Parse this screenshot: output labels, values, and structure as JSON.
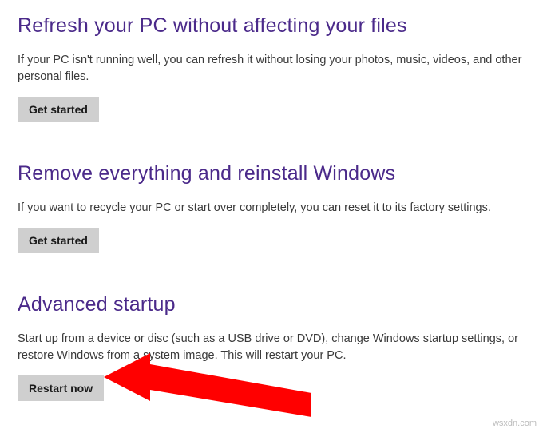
{
  "sections": {
    "refresh": {
      "title": "Refresh your PC without affecting your files",
      "desc": "If your PC isn't running well, you can refresh it without losing your photos, music, videos, and other personal files.",
      "button": "Get started"
    },
    "remove": {
      "title": "Remove everything and reinstall Windows",
      "desc": "If you want to recycle your PC or start over completely, you can reset it to its factory settings.",
      "button": "Get started"
    },
    "advanced": {
      "title": "Advanced startup",
      "desc": "Start up from a device or disc (such as a USB drive or DVD), change Windows startup settings, or restore Windows from a system image. This will restart your PC.",
      "button": "Restart now"
    }
  },
  "watermark": "wsxdn.com",
  "colors": {
    "heading": "#4b2a8a",
    "button_bg": "#cfcfcf",
    "arrow": "#ff0000"
  }
}
